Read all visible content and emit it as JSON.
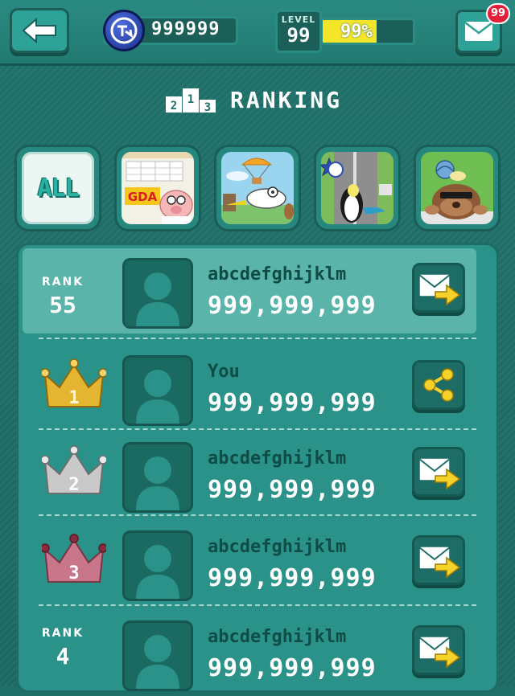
{
  "header": {
    "coins": "999999",
    "level_label": "LEVEL",
    "level_value": "99",
    "level_progress_text": "99%",
    "level_progress_fraction": 0.6,
    "mail_count": "99"
  },
  "title": "RANKING",
  "podium_labels": [
    "2",
    "1",
    "3"
  ],
  "tabs": {
    "all_label": "ALL",
    "game_icons": [
      "gda-pig-game",
      "parachute-bird-game",
      "penguin-road-game",
      "mole-snail-game"
    ]
  },
  "rows": [
    {
      "type": "rank",
      "rank_label": "RANK",
      "rank": "55",
      "name": "abcdefghijklm",
      "score": "999,999,999",
      "action": "send-mail"
    },
    {
      "type": "crown",
      "crown_color": "gold",
      "rank": "1",
      "name": "You",
      "score": "999,999,999",
      "action": "share"
    },
    {
      "type": "crown",
      "crown_color": "silver",
      "rank": "2",
      "name": "abcdefghijklm",
      "score": "999,999,999",
      "action": "send-mail"
    },
    {
      "type": "crown",
      "crown_color": "bronze",
      "rank": "3",
      "name": "abcdefghijklm",
      "score": "999,999,999",
      "action": "send-mail"
    },
    {
      "type": "rank",
      "rank_label": "RANK",
      "rank": "4",
      "name": "abcdefghijklm",
      "score": "999,999,999",
      "action": "send-mail"
    }
  ],
  "colors": {
    "background": "#1f6f68",
    "panel": "#2a9288",
    "highlight_row": "#5ab4aa",
    "xp_fill": "#f5e62a",
    "badge_red": "#e0203a",
    "gold": "#e4b531",
    "silver": "#c9c9c9",
    "bronze": "#c9768a"
  }
}
